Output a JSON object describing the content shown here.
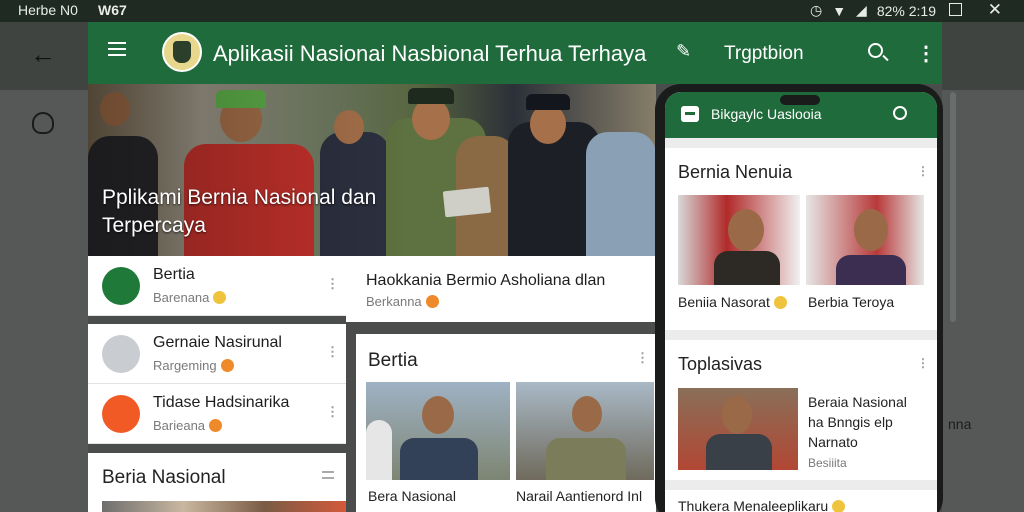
{
  "status_bar": {
    "left_text": "Herbe N0",
    "device": "W67",
    "right_text": "82% 2:19"
  },
  "app_bar": {
    "title": "Aplikasii Nasionai Nasbional Terhua Terhaya",
    "tab_label": "Trgptbion"
  },
  "hero": {
    "headline": "Pplikami Bernia Nasional dan Terpercaya"
  },
  "list_rows": [
    {
      "title": "Bertia",
      "subtitle": "Barenana",
      "icon_color": "#1f7a3a"
    },
    {
      "title": "Gernaie Nasirunal",
      "subtitle": "Rargeming",
      "icon_color": "#d9d9d9"
    },
    {
      "title": "Tidase Hadsinarika",
      "subtitle": "Barieana",
      "icon_color": "#f15a24"
    }
  ],
  "headline_card": {
    "title": "Haokkania Bermio Asholiana dlan",
    "subtitle": "Berkanna"
  },
  "berita_card": {
    "heading": "Bertia",
    "captions": [
      "Bera Nasional",
      "Narail Aantienord Inl"
    ]
  },
  "nasional_card": {
    "heading": "Beria Nasional"
  },
  "right_label": "nna",
  "phone": {
    "app_title": "Bikgaylc Uaslooia",
    "section1": {
      "heading": "Bernia Nenuia",
      "captions": [
        "Beniia Nasorat",
        "Berbia Teroya"
      ]
    },
    "section2": {
      "heading": "Toplasivas",
      "article": {
        "line1": "Beraia Nasional",
        "line2": "ha Bnngis elp",
        "line3": "Narnato",
        "source": "Besiiita"
      }
    },
    "footer_text": "Thukera Menaleeplikaru"
  }
}
